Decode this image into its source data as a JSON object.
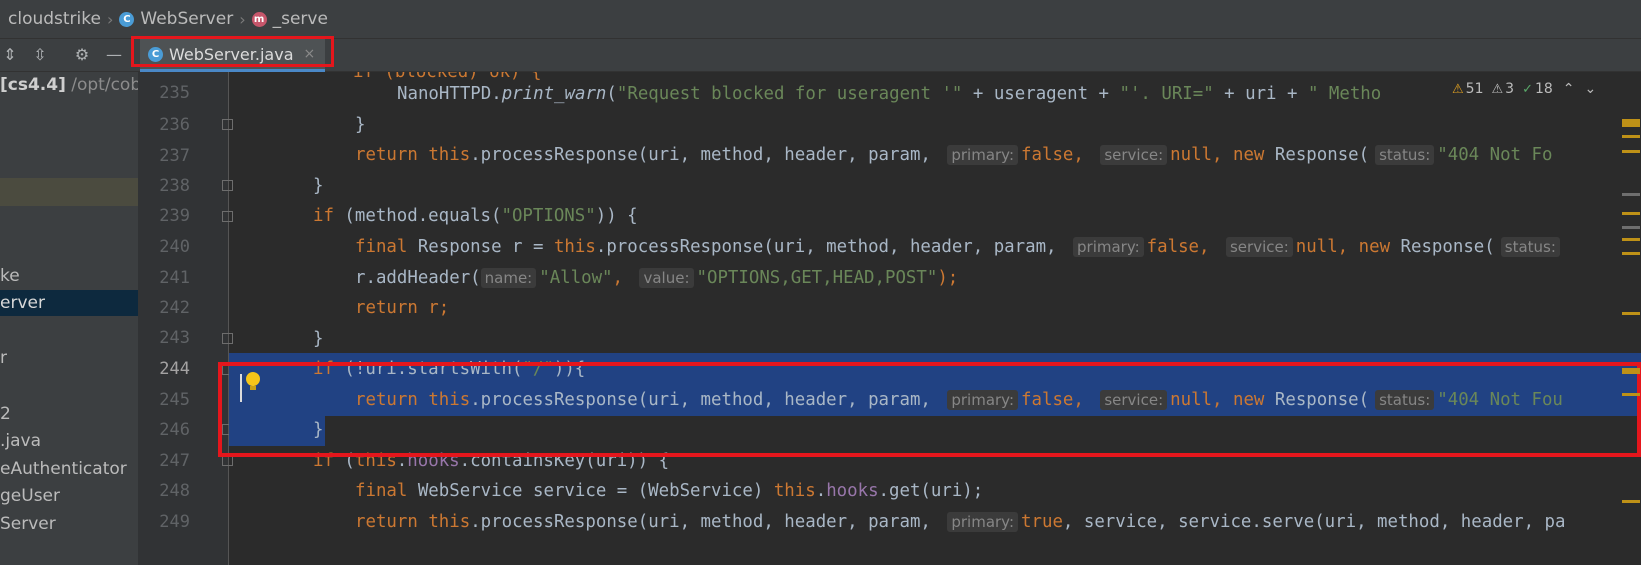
{
  "breadcrumb": {
    "project": "cloudstrike",
    "class": "WebServer",
    "method": "_serve",
    "class_icon": "C",
    "method_icon": "m"
  },
  "tab": {
    "label": "WebServer.java",
    "close": "×"
  },
  "sidebar": {
    "header_bold": "[cs4.4]",
    "header_path": "/opt/cob",
    "items": [
      "ke",
      "erver",
      "r",
      "2",
      ".java",
      "eAuthenticator",
      "geUser",
      "Server"
    ]
  },
  "inspections": {
    "warnings": "51",
    "weak_warnings": "3",
    "typos": "18"
  },
  "gutter": {
    "lines": [
      "235",
      "236",
      "237",
      "238",
      "239",
      "240",
      "241",
      "242",
      "243",
      "244",
      "245",
      "246",
      "247",
      "248",
      "249"
    ]
  },
  "code": {
    "l234": "if (blocked) ok) {",
    "l235_a": "NanoHTTPD.",
    "l235_fn": "print_warn",
    "l235_b": "(",
    "l235_s1": "\"Request blocked for useragent '\"",
    "l235_c": " + useragent + ",
    "l235_s2": "\"'. URI=\"",
    "l235_d": " + uri + ",
    "l235_s3": "\" Metho",
    "l236": "}",
    "return": "return",
    "this": "this",
    "new": "new",
    "final": "final",
    "if": "if",
    "false": "false",
    "true": "true",
    "null": "null",
    "processResponse_args": ".processResponse(uri, method, header, param, ",
    "primary": "primary:",
    "service": "service:",
    "status": "status:",
    "name": "name:",
    "value": "value:",
    "sep": ", ",
    "newResp": " Response(",
    "l237_s": "\"404 Not Fo",
    "l238": "}",
    "l239_a": " (method.equals(",
    "l239_s": "\"OPTIONS\"",
    "l239_b": ")) {",
    "l240_a": " Response r = ",
    "l241_a": "r.addHeader(",
    "l241_s1": "\"Allow\"",
    "l241_s2": "\"OPTIONS,GET,HEAD,POST\"",
    "l241_b": ");",
    "l242_b": " r;",
    "l243": "}",
    "l244_a": " (!uri.startsWith(",
    "l244_s": "\"/\"",
    "l244_b": ")){",
    "l245_s": "\"404 Not Fou",
    "l246": "}",
    "l247_a": " (",
    "l247_f": "hooks",
    "l247_b": ".containsKey(uri)) {",
    "l248_a": " WebService service = (WebService) ",
    "l248_f": "hooks",
    "l248_b": ".get(uri);",
    "l249_b": ", service, service.serve(uri, method, header, pa"
  }
}
